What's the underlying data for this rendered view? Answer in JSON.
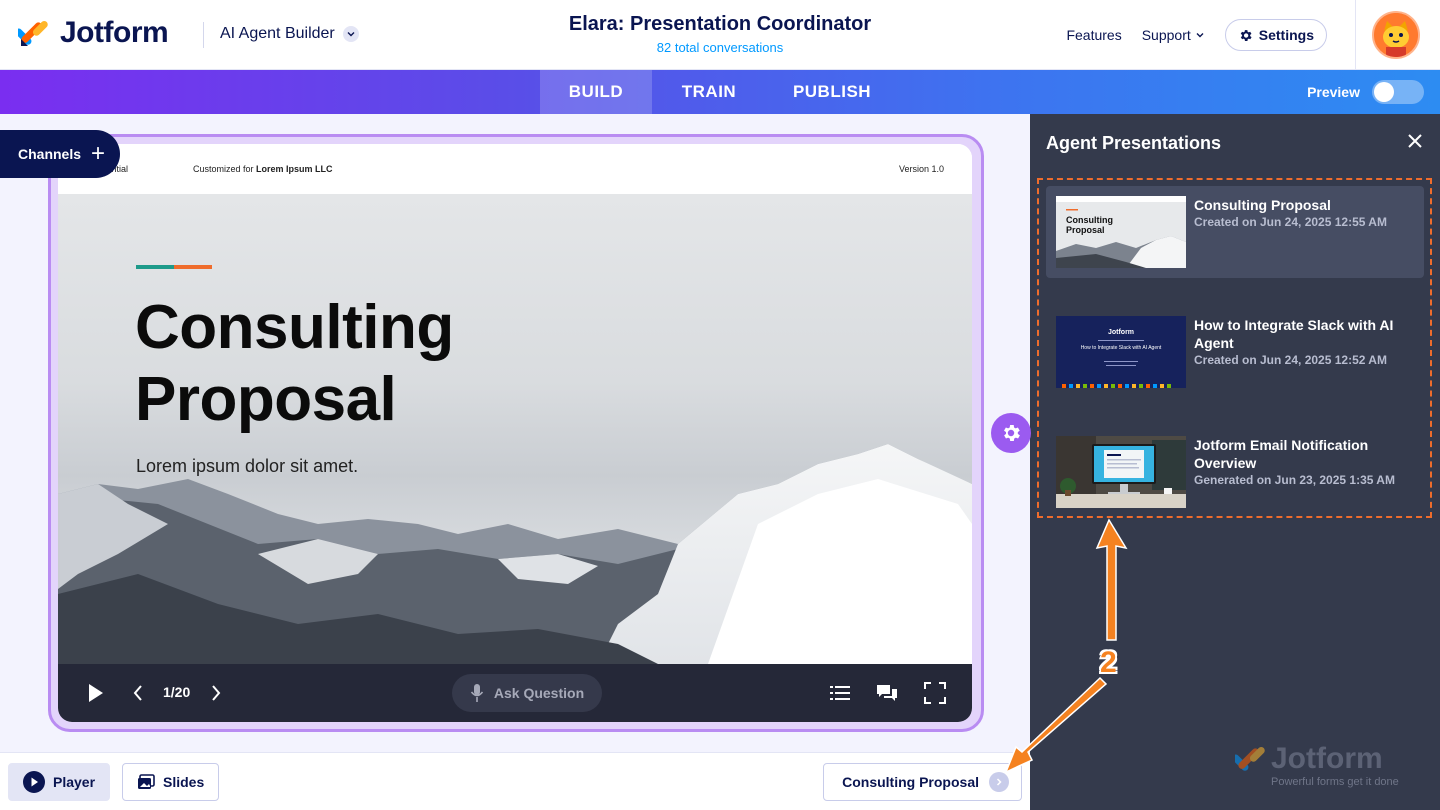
{
  "header": {
    "brand": "Jotform",
    "builder_label": "AI Agent Builder",
    "agent_title": "Elara: Presentation Coordinator",
    "conversations": "82 total conversations",
    "features": "Features",
    "support": "Support",
    "settings": "Settings"
  },
  "nav": {
    "tabs": [
      {
        "label": "BUILD",
        "active": true
      },
      {
        "label": "TRAIN",
        "active": false
      },
      {
        "label": "PUBLISH",
        "active": false
      }
    ],
    "preview_label": "Preview",
    "preview_on": false
  },
  "channels_label": "Channels",
  "slide": {
    "top_left": "...ntial",
    "customized_prefix": "Customized for ",
    "customized_company": "Lorem Ipsum LLC",
    "version": "Version 1.0",
    "title_line1": "Consulting",
    "title_line2": "Proposal",
    "subtitle": "Lorem ipsum dolor sit amet.",
    "accent_colors": [
      "#1e9a8a",
      "#ef6c2c"
    ]
  },
  "player": {
    "pager": "1/20",
    "ask_question": "Ask Question"
  },
  "bottom": {
    "player_label": "Player",
    "slides_label": "Slides",
    "current_presentation": "Consulting Proposal"
  },
  "panel": {
    "title": "Agent Presentations",
    "items": [
      {
        "title": "Consulting Proposal",
        "date": "Created on Jun 24, 2025 12:55 AM",
        "thumb": "mountain",
        "selected": true
      },
      {
        "title": "How to Integrate Slack with AI Agent",
        "date": "Created on Jun 24, 2025 12:52 AM",
        "thumb": "slack",
        "selected": false
      },
      {
        "title": "Jotform Email Notification Overview",
        "date": "Generated on Jun 23, 2025 1:35 AM",
        "thumb": "desk",
        "selected": false
      }
    ],
    "thumb_consulting_title": "Consulting Proposal",
    "thumb_slack_brand": "Jotform",
    "thumb_slack_title": "How to Integrate Slack with AI Agent",
    "watermark_brand": "Jotform",
    "watermark_tagline": "Powerful forms get it done"
  },
  "annotation": {
    "number": "2",
    "color": "#f58220"
  }
}
